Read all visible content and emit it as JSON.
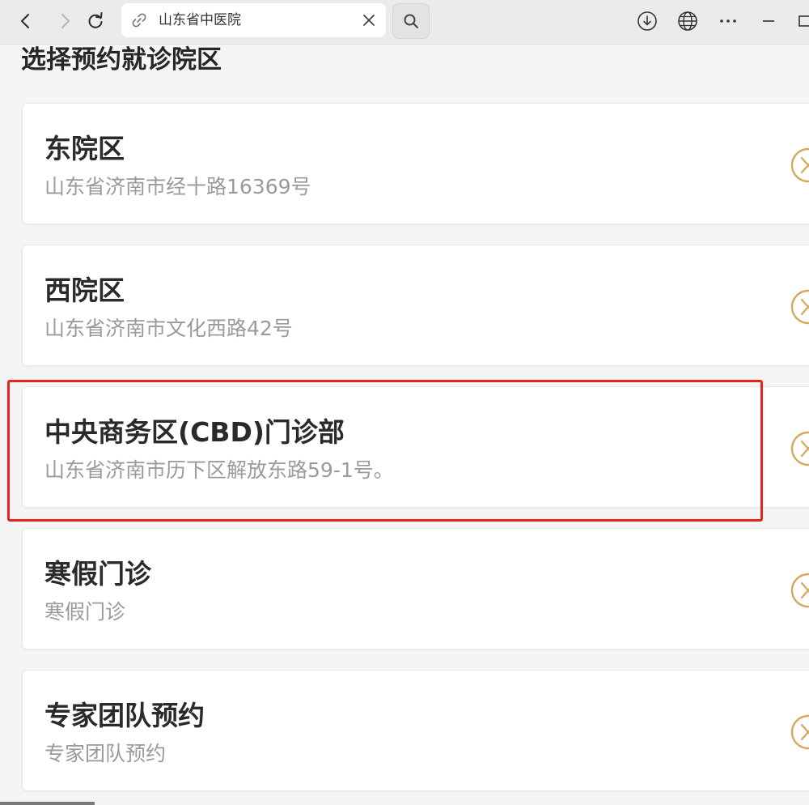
{
  "browser": {
    "address_text": "山东省中医院",
    "icons": [
      "back-icon",
      "forward-icon",
      "reload-icon",
      "link-icon",
      "clear-icon",
      "search-icon",
      "download-icon",
      "globe-icon",
      "more-icon",
      "minimize-icon"
    ]
  },
  "page": {
    "title": "选择预约就诊院区",
    "campuses": [
      {
        "name": "东院区",
        "address": "山东省济南市经十路16369号"
      },
      {
        "name": "西院区",
        "address": "山东省济南市文化西路42号"
      },
      {
        "name": "中央商务区(CBD)门诊部",
        "address": "山东省济南市历下区解放东路59-1号。"
      },
      {
        "name": "寒假门诊",
        "address": "寒假门诊"
      },
      {
        "name": "专家团队预约",
        "address": "专家团队预约"
      }
    ],
    "highlighted_index": 2
  },
  "colors": {
    "accent_gold": "#d4a95c",
    "highlight_red": "#e8231c",
    "secondary_text": "#9a9a9a"
  }
}
